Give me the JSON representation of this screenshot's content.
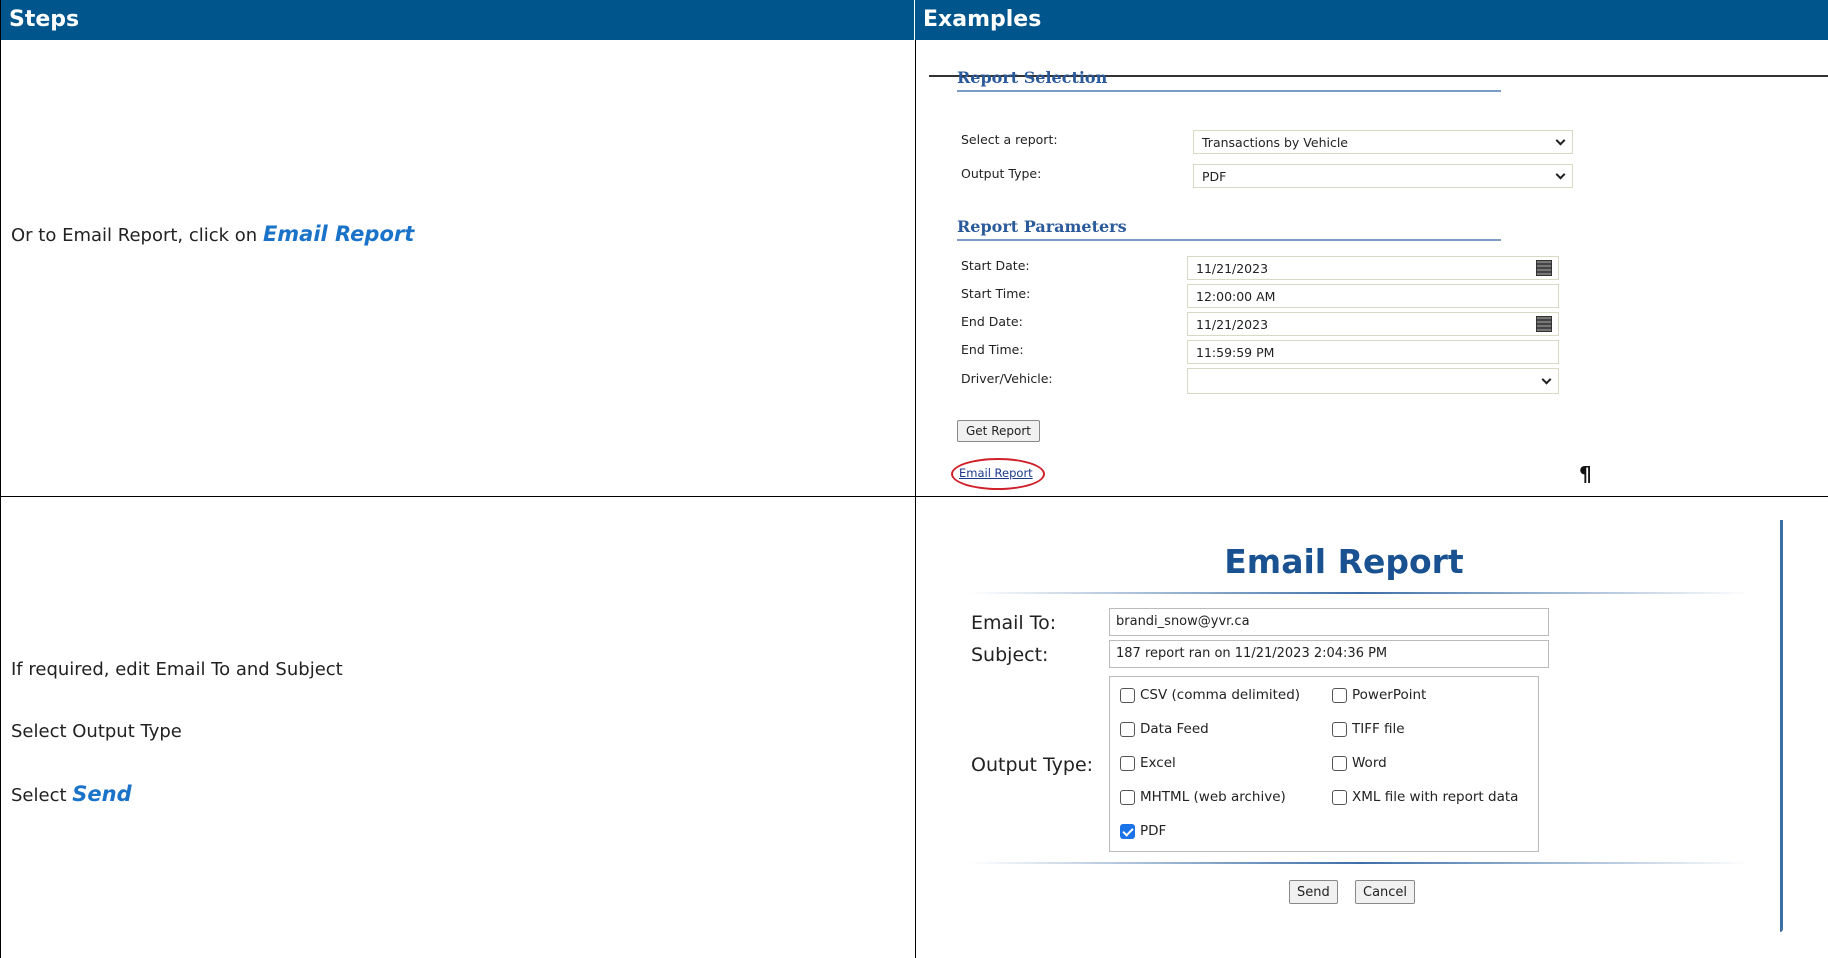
{
  "header": {
    "steps": "Steps",
    "examples": "Examples"
  },
  "row1": {
    "step_prefix": "Or to Email Report, click on ",
    "step_link": "Email Report",
    "report_selection": {
      "section_title": "Report Selection",
      "select_report_label": "Select a report:",
      "select_report_value": "Transactions by Vehicle",
      "output_type_label": "Output Type:",
      "output_type_value": "PDF"
    },
    "report_parameters": {
      "section_title": "Report Parameters",
      "start_date_label": "Start Date:",
      "start_date_value": "11/21/2023",
      "start_time_label": "Start Time:",
      "start_time_value": "12:00:00 AM",
      "end_date_label": "End Date:",
      "end_date_value": "11/21/2023",
      "end_time_label": "End Time:",
      "end_time_value": "11:59:59 PM",
      "driver_vehicle_label": "Driver/Vehicle:",
      "driver_vehicle_value": ""
    },
    "get_report_button": "Get Report",
    "email_report_link": "Email Report",
    "pilcrow": "¶"
  },
  "row2": {
    "step_line1": "If required, edit Email To and Subject",
    "step_line2": "Select Output Type",
    "step_line3_prefix": "Select ",
    "step_line3_link": "Send",
    "dialog": {
      "title": "Email Report",
      "email_to_label": "Email To:",
      "email_to_value": "brandi_snow@yvr.ca",
      "subject_label": "Subject:",
      "subject_value": "187 report ran on 11/21/2023 2:04:36 PM",
      "output_type_label": "Output Type:",
      "options": [
        {
          "label": "CSV (comma delimited)",
          "checked": false
        },
        {
          "label": "PowerPoint",
          "checked": false
        },
        {
          "label": "Data Feed",
          "checked": false
        },
        {
          "label": "TIFF file",
          "checked": false
        },
        {
          "label": "Excel",
          "checked": false
        },
        {
          "label": "Word",
          "checked": false
        },
        {
          "label": "MHTML (web archive)",
          "checked": false
        },
        {
          "label": "XML file with report data",
          "checked": false
        },
        {
          "label": "PDF",
          "checked": true
        }
      ],
      "send_button": "Send",
      "cancel_button": "Cancel"
    }
  }
}
